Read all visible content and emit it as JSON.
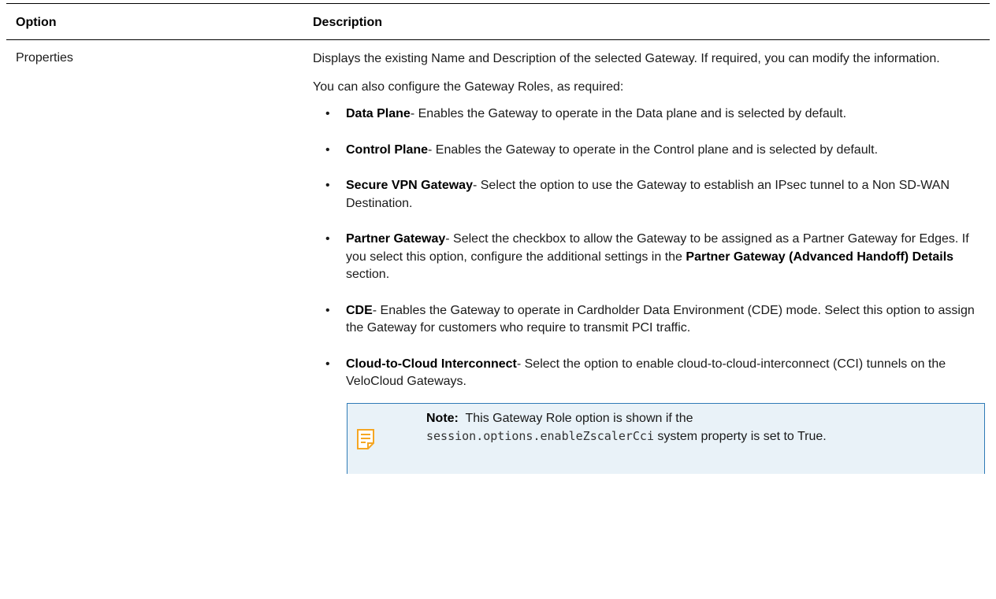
{
  "table": {
    "headers": {
      "option": "Option",
      "description": "Description"
    },
    "row": {
      "option": "Properties",
      "para1": "Displays the existing Name and Description of the selected Gateway. If required, you can modify the information.",
      "para2": "You can also configure the Gateway Roles, as required:",
      "roles": [
        {
          "term": "Data Plane",
          "text": "- Enables the Gateway to operate in the Data plane and is selected by default."
        },
        {
          "term": "Control Plane",
          "text": "- Enables the Gateway to operate in the Control plane and is selected by default."
        },
        {
          "term": "Secure VPN Gateway",
          "text": "- Select the option to use the Gateway to establish an IPsec tunnel to a Non SD-WAN Destination."
        },
        {
          "term": "Partner Gateway",
          "text_before": "- Select the checkbox to allow the Gateway to be assigned as a Partner Gateway for Edges. If you select this option, configure the additional settings in the ",
          "bold_inline": "Partner Gateway (Advanced Handoff) Details",
          "text_after": " section."
        },
        {
          "term": "CDE",
          "text": "- Enables the Gateway to operate in Cardholder Data Environment (CDE) mode. Select this option to assign the Gateway for customers who require to transmit PCI traffic."
        },
        {
          "term": "Cloud-to-Cloud Interconnect",
          "text": "- Select the option to enable cloud-to-cloud-interconnect (CCI) tunnels on the VeloCloud Gateways."
        }
      ],
      "note": {
        "label": "Note:",
        "text_before": "This Gateway Role option is shown if the",
        "code": "session.options.enableZscalerCci",
        "text_after": " system property is set to True.",
        "icon": "note-icon"
      }
    }
  },
  "colors": {
    "note_background": "#e9f2f8",
    "note_border": "#2f7bb7",
    "note_icon": "#f5a623"
  }
}
